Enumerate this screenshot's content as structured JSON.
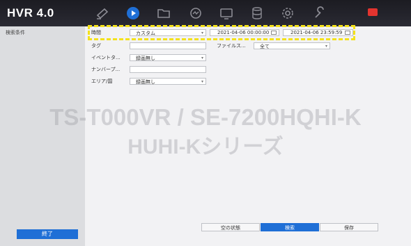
{
  "app": {
    "title": "HVR 4.0"
  },
  "nav": {
    "icons": [
      "live-view-icon",
      "playback-icon",
      "folder-icon",
      "smart-search-icon",
      "display-icon",
      "storage-icon",
      "settings-icon",
      "maintenance-icon"
    ],
    "alert_badge": "•"
  },
  "sidebar": {
    "title": "検索条件",
    "exit_label": "終了"
  },
  "filters": {
    "time_label": "時間",
    "time_mode": "カスタム",
    "start_datetime": "2021-04-06 00:00:00",
    "end_datetime": "2021-04-06 23:59:59",
    "tag_label": "タグ",
    "event_type_label": "イベントタ...",
    "event_type_value": "録画無し",
    "number_plate_label": "ナンバープ...",
    "area_country_label": "エリア/国",
    "area_country_value": "録画無し",
    "file_status_label": "ファイルス...",
    "file_status_value": "全て"
  },
  "watermark": {
    "line1": "TS-T000VR / SE-7200HQHI-K",
    "line2": "HUHI-Kシリーズ"
  },
  "actions": {
    "clear_label": "空の状態",
    "search_label": "検索",
    "save_label": "保存"
  },
  "colors": {
    "accent": "#1f6fd6",
    "highlight": "#f4e21b",
    "topbar": "#1c1c22"
  }
}
